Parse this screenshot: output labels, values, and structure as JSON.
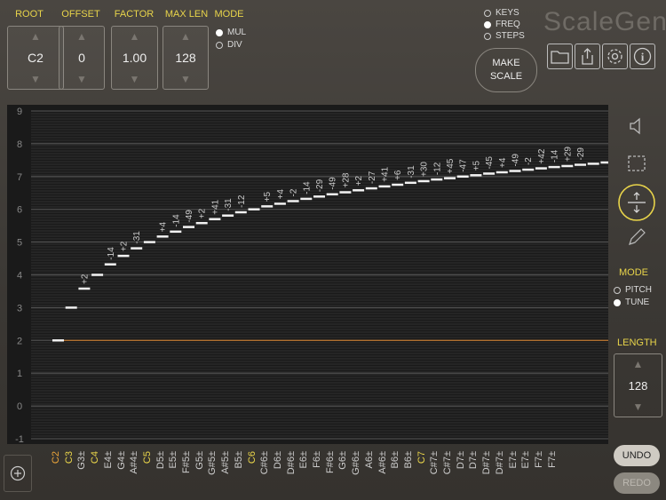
{
  "app_title": "ScaleGen",
  "controls": {
    "root": {
      "label": "ROOT",
      "value": "C2"
    },
    "offset": {
      "label": "OFFSET",
      "value": "0"
    },
    "factor": {
      "label": "FACTOR",
      "value": "1.00"
    },
    "max_len": {
      "label": "MAX LEN",
      "value": "128"
    }
  },
  "mode_top": {
    "label": "MODE",
    "options": [
      "MUL",
      "DIV"
    ],
    "selected": "MUL"
  },
  "view_options": {
    "options": [
      "KEYS",
      "FREQ",
      "STEPS"
    ],
    "selected": "FREQ"
  },
  "make_scale_label": "MAKE\nSCALE",
  "toolbar_icons": [
    "folder-icon",
    "share-icon",
    "gear-icon",
    "info-icon"
  ],
  "side_tools": [
    "speaker-icon",
    "select-icon",
    "move-vertical-icon",
    "pencil-icon"
  ],
  "mode_side": {
    "label": "MODE",
    "options": [
      "PITCH",
      "TUNE"
    ],
    "selected": "TUNE"
  },
  "length": {
    "label": "LENGTH",
    "value": "128"
  },
  "undo_label": "UNDO",
  "redo_label": "REDO",
  "colors": {
    "accent": "#e8d44a",
    "root_line": "#d9822b",
    "note_octave": "#e8a33a"
  },
  "chart_data": {
    "type": "scatter",
    "ylim": [
      -1,
      9
    ],
    "y_ticks": [
      -1,
      0,
      1,
      2,
      3,
      4,
      5,
      6,
      7,
      8,
      9
    ],
    "reference_line_y": 2,
    "notes": [
      "C2",
      "C3",
      "G3±",
      "C4",
      "E4±",
      "G4±",
      "A#4±",
      "C5",
      "D5±",
      "E5±",
      "F#5±",
      "G5±",
      "G#5±",
      "A#5±",
      "B5±",
      "C6",
      "C#6±",
      "D6±",
      "D#6±",
      "E6±",
      "F6±",
      "F#6±",
      "G6±",
      "G#6±",
      "A6±",
      "A#6±",
      "B6±",
      "B6±",
      "C7",
      "C#7±",
      "C#7±",
      "D7±",
      "D7±",
      "D#7±",
      "D#7±",
      "E7±",
      "E7±",
      "F7±",
      "F7±"
    ],
    "octave_notes": [
      "C2",
      "C3",
      "C4",
      "C5",
      "C6",
      "C7"
    ],
    "cents": [
      "",
      "",
      "+2",
      "",
      "-14",
      "+2",
      "-31",
      "",
      "+4",
      "-14",
      "-49",
      "+2",
      "+41",
      "-31",
      "-12",
      "",
      "+5",
      "+4",
      "-2",
      "-14",
      "-29",
      "-49",
      "+28",
      "+2",
      "-27",
      "+41",
      "+6",
      "-31",
      "+30",
      "-12",
      "+45",
      "-47",
      "+5",
      "-45",
      "+4",
      "-49",
      "-2",
      "+42",
      "-14",
      "+29",
      "-29"
    ],
    "values": [
      2.0,
      3.0,
      3.58,
      4.0,
      4.32,
      4.58,
      4.81,
      5.0,
      5.17,
      5.32,
      5.46,
      5.58,
      5.7,
      5.81,
      5.91,
      6.0,
      6.09,
      6.17,
      6.25,
      6.32,
      6.39,
      6.46,
      6.52,
      6.58,
      6.64,
      6.7,
      6.75,
      6.81,
      6.86,
      6.91,
      6.95,
      7.0,
      7.04,
      7.09,
      7.13,
      7.17,
      7.21,
      7.25,
      7.29,
      7.32,
      7.36,
      7.39,
      7.43
    ]
  }
}
